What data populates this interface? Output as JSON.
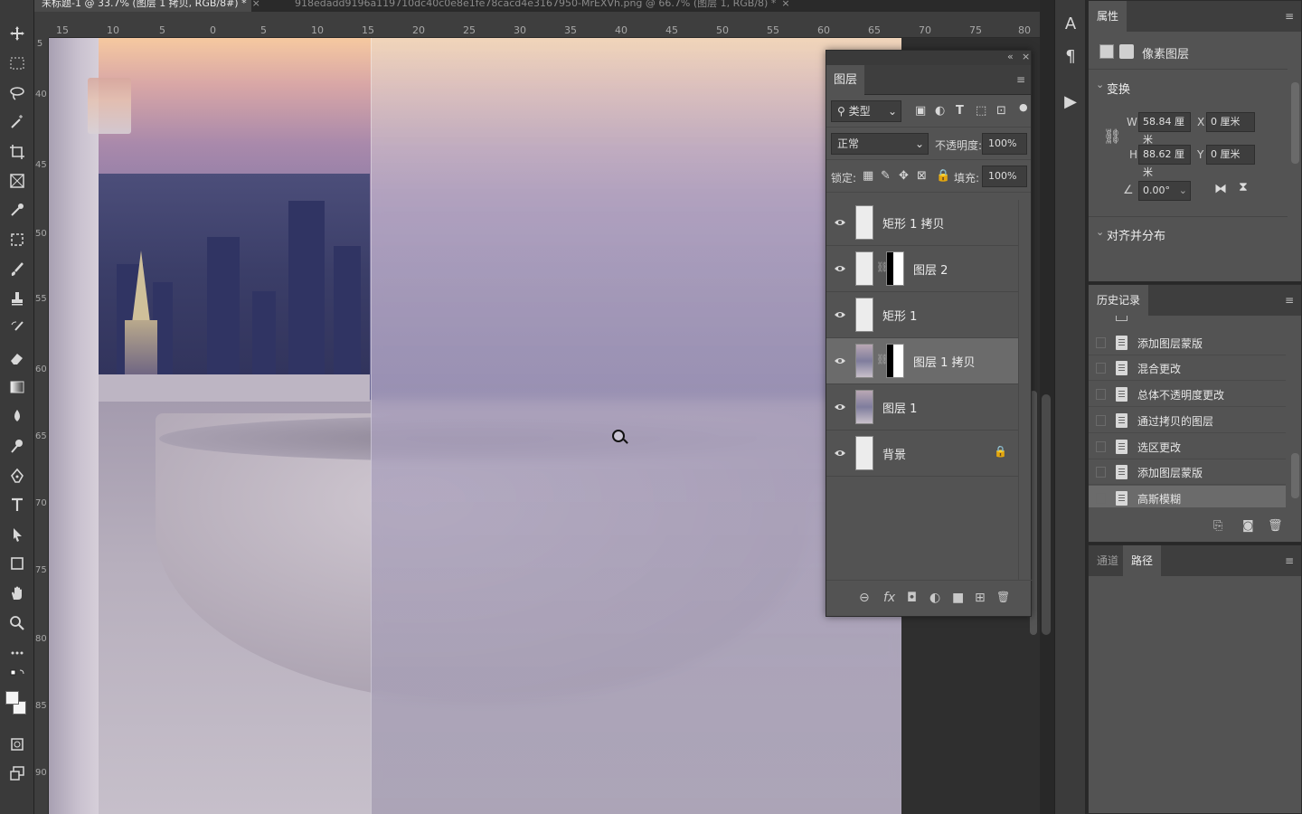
{
  "document_tabs": [
    {
      "label": "未标题-1 @ 33.7% (图层 1 拷贝, RGB/8#) *",
      "active": true
    },
    {
      "label": "918edadd9196a119710dc40c0e8e1fe78cacd4e3167950-MrEXVh.png @ 66.7% (图层 1, RGB/8) *",
      "active": false
    }
  ],
  "tab_close": "×",
  "ruler_top_labels": [
    "15",
    "10",
    "5",
    "0",
    "5",
    "10",
    "15",
    "20",
    "25",
    "30",
    "35",
    "40",
    "45",
    "50",
    "55",
    "60",
    "65",
    "70",
    "75",
    "80"
  ],
  "ruler_left_labels": [
    "5",
    "40",
    "45",
    "50",
    "55",
    "60",
    "65",
    "70",
    "75",
    "80",
    "85",
    "90"
  ],
  "layers_panel": {
    "collapse": "«",
    "close": "×",
    "tab": "图层",
    "menu": "≡",
    "filter_kind": "类型",
    "blend_mode": "正常",
    "opacity_label": "不透明度:",
    "opacity_value": "100%",
    "lock_label": "锁定:",
    "fill_label": "填充:",
    "fill_value": "100%",
    "layers": [
      {
        "name": "矩形 1 拷贝",
        "visible": true,
        "selected": false,
        "mask": false,
        "locked": false
      },
      {
        "name": "图层 2",
        "visible": true,
        "selected": false,
        "mask": true,
        "locked": false
      },
      {
        "name": "矩形 1",
        "visible": true,
        "selected": false,
        "mask": false,
        "locked": false
      },
      {
        "name": "图层 1 拷贝",
        "visible": true,
        "selected": true,
        "mask": true,
        "locked": false
      },
      {
        "name": "图层 1",
        "visible": true,
        "selected": false,
        "mask": false,
        "locked": false
      },
      {
        "name": "背景",
        "visible": true,
        "selected": false,
        "mask": false,
        "locked": true
      }
    ],
    "footer_icons": [
      "link-icon",
      "fx-icon",
      "mask-icon",
      "adjustment-icon",
      "folder-icon",
      "new-layer-icon",
      "trash-icon"
    ],
    "footer_glyphs": [
      "⊖",
      "fx",
      "◘",
      "◐",
      "■",
      "⊞",
      "🗑"
    ]
  },
  "properties_panel": {
    "tab": "属性",
    "menu": "≡",
    "kind": "像素图层",
    "transform_title": "变换",
    "w_label": "W",
    "w_value": "58.84 厘米",
    "h_label": "H",
    "h_value": "88.62 厘米",
    "x_label": "X",
    "x_value": "0 厘米",
    "y_label": "Y",
    "y_value": "0 厘米",
    "angle_value": "0.00°",
    "align_title": "对齐并分布"
  },
  "history_panel": {
    "tab": "历史记录",
    "menu": "≡",
    "items": [
      {
        "label": "添加图层蒙版",
        "active": false
      },
      {
        "label": "混合更改",
        "active": false
      },
      {
        "label": "总体不透明度更改",
        "active": false
      },
      {
        "label": "通过拷贝的图层",
        "active": false
      },
      {
        "label": "选区更改",
        "active": false
      },
      {
        "label": "添加图层蒙版",
        "active": false
      },
      {
        "label": "高斯模糊",
        "active": true
      }
    ]
  },
  "channels_panel": {
    "tabs": [
      {
        "label": "通道",
        "active": false
      },
      {
        "label": "路径",
        "active": true
      }
    ],
    "menu": "≡"
  },
  "icon_column": [
    "A",
    "¶",
    "▶"
  ]
}
